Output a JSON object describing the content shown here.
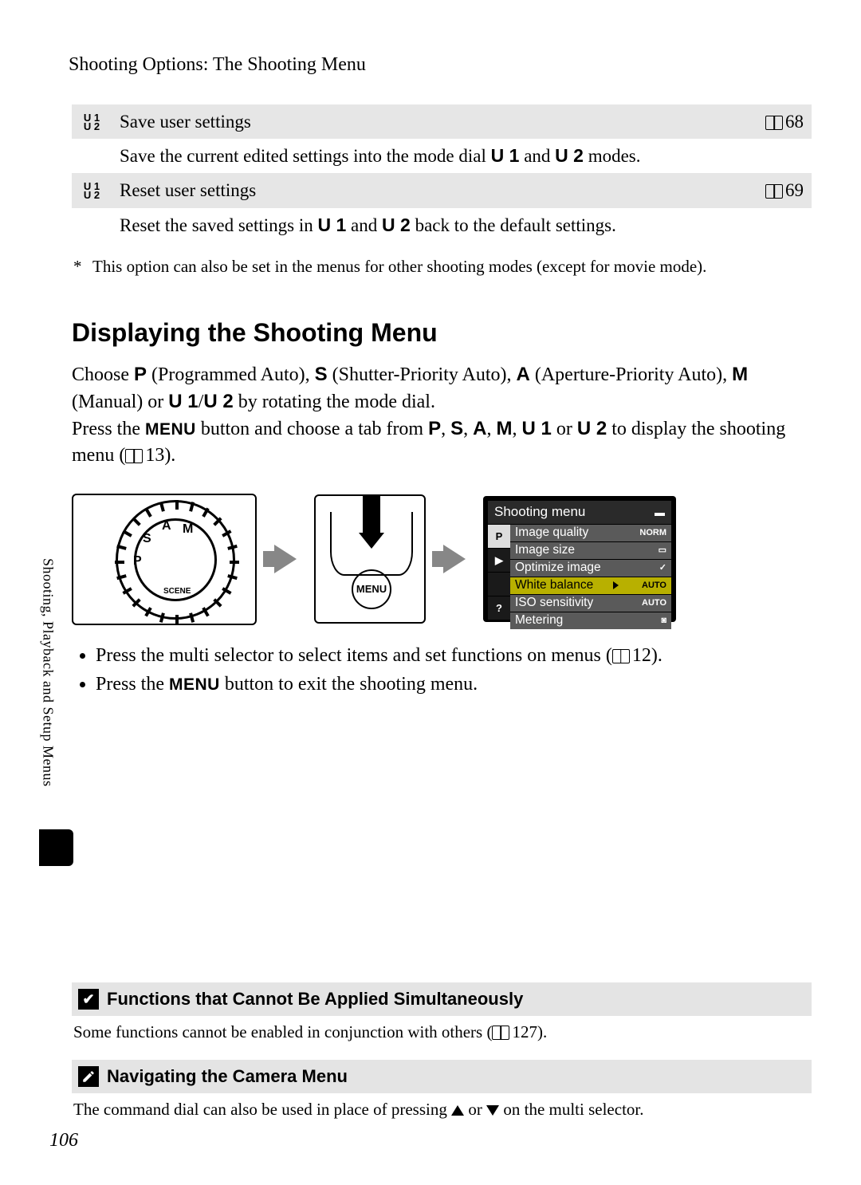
{
  "page_number": "106",
  "side_tab": "Shooting, Playback and Setup Menus",
  "header": "Shooting Options: The Shooting Menu",
  "rows": [
    {
      "icon_top": "U 1",
      "icon_bot": "U 2",
      "title": "Save user settings",
      "page_ref": "68",
      "desc_pre": "Save the current edited settings into the mode dial ",
      "u1": "U 1",
      "mid": " and ",
      "u2": "U 2",
      "desc_post": " modes."
    },
    {
      "icon_top": "U 1",
      "icon_bot": "U 2",
      "title": "Reset user settings",
      "page_ref": "69",
      "desc_pre": "Reset the saved settings in ",
      "u1": "U 1",
      "mid": " and ",
      "u2": "U 2",
      "desc_post": " back to the default settings."
    }
  ],
  "footnote_mark": "*",
  "footnote": "This option can also be set in the menus for other shooting modes (except for movie mode).",
  "section_heading": "Displaying the Shooting Menu",
  "para1": {
    "a": "Choose ",
    "P": "P",
    "b": " (Programmed Auto), ",
    "S": "S",
    "c": " (Shutter-Priority Auto), ",
    "A": "A",
    "d": " (Aperture-Priority Auto), ",
    "M": "M",
    "e": " (Manual) or ",
    "U1": "U 1",
    "slash": "/",
    "U2": "U 2",
    "f": " by rotating the mode dial."
  },
  "para2": {
    "a": "Press the ",
    "menu": "MENU",
    "b": " button and choose a tab from ",
    "P": "P",
    "c1": ", ",
    "S": "S",
    "c2": ", ",
    "A": "A",
    "c3": ", ",
    "M": "M",
    "c4": ", ",
    "U1": "U 1",
    "or": " or ",
    "U2": "U 2",
    "d": " to display the shooting menu (",
    "ref": "13",
    "e": ")."
  },
  "lcd": {
    "title": "Shooting menu",
    "left": [
      "P",
      "▶",
      " ",
      "?"
    ],
    "rows": [
      {
        "label": "Image quality",
        "right": "NORM"
      },
      {
        "label": "Image size",
        "right": "▭"
      },
      {
        "label": "Optimize image",
        "right": "✓"
      },
      {
        "label": "White balance",
        "right": "AUTO",
        "sel": true
      },
      {
        "label": "ISO sensitivity",
        "right": "AUTO"
      },
      {
        "label": "Metering",
        "right": "◙"
      }
    ]
  },
  "menu_btn": "MENU",
  "dial_letters": {
    "P": "P",
    "A": "A",
    "S": "S",
    "M": "M",
    "SCENE": "SCENE"
  },
  "bullets": {
    "b1a": "Press the multi selector to select items and set functions on menus (",
    "b1ref": "12",
    "b1b": ").",
    "b2a": "Press the ",
    "b2menu": "MENU",
    "b2b": " button to exit the shooting menu."
  },
  "note1": {
    "title": "Functions that Cannot Be Applied Simultaneously",
    "body_a": "Some functions cannot be enabled in conjunction with others (",
    "ref": "127",
    "body_b": ")."
  },
  "note2": {
    "title": "Navigating the Camera Menu",
    "body_a": "The command dial can also be used in place of pressing ",
    "or": " or ",
    "body_b": " on the multi selector."
  }
}
